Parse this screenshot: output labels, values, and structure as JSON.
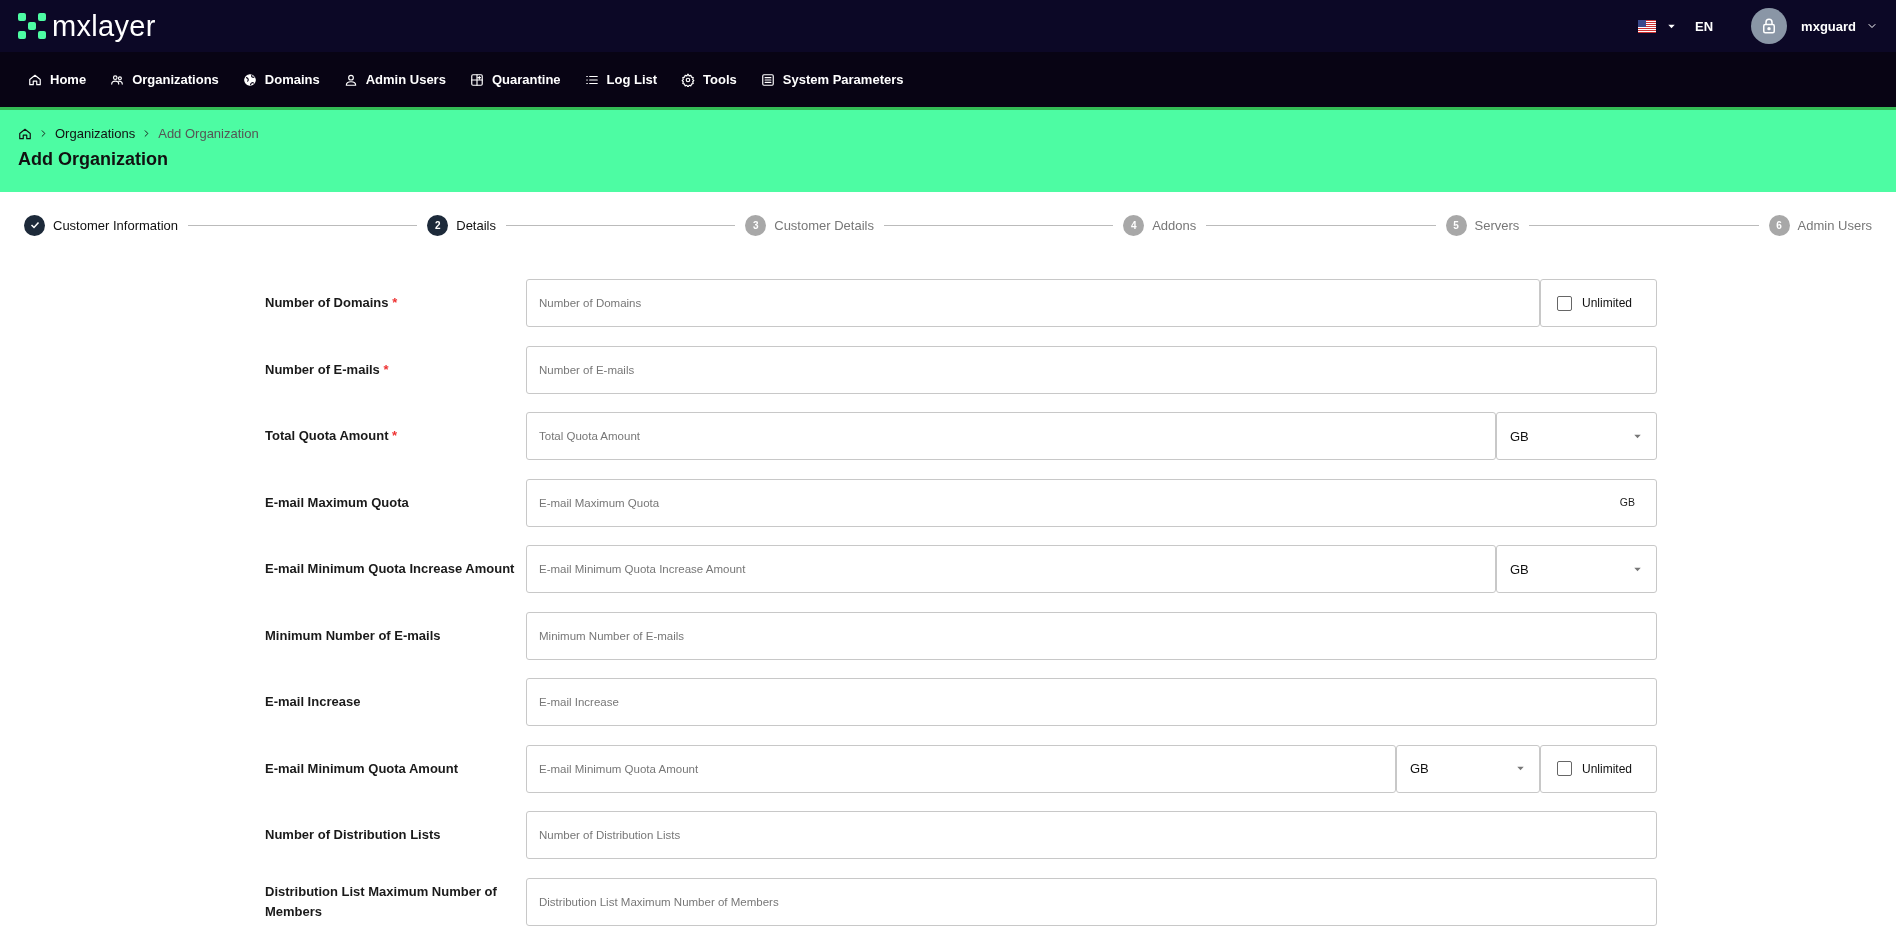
{
  "brand": {
    "name": "mxlayer"
  },
  "topbar": {
    "language": "EN",
    "user": "mxguard"
  },
  "nav": [
    {
      "label": "Home"
    },
    {
      "label": "Organizations"
    },
    {
      "label": "Domains"
    },
    {
      "label": "Admin Users"
    },
    {
      "label": "Quarantine"
    },
    {
      "label": "Log List"
    },
    {
      "label": "Tools"
    },
    {
      "label": "System Parameters"
    }
  ],
  "breadcrumb": [
    {
      "label": "Organizations",
      "current": false
    },
    {
      "label": "Add Organization",
      "current": true
    }
  ],
  "page_title": "Add Organization",
  "steps": [
    {
      "label": "Customer Information",
      "completed": true,
      "selected": false
    },
    {
      "number": "2",
      "label": "Details",
      "completed": false,
      "selected": true
    },
    {
      "number": "3",
      "label": "Customer Details",
      "completed": false,
      "selected": false
    },
    {
      "number": "4",
      "label": "Addons",
      "completed": false,
      "selected": false
    },
    {
      "number": "5",
      "label": "Servers",
      "completed": false,
      "selected": false
    },
    {
      "number": "6",
      "label": "Admin Users",
      "completed": false,
      "selected": false
    }
  ],
  "fields": [
    {
      "label": "Number of Domains",
      "required_mark": "*",
      "placeholder": "Number of Domains",
      "addons": [
        {
          "kind": "checkbox",
          "label": "Unlimited",
          "checked": false
        }
      ]
    },
    {
      "label": "Number of E-mails",
      "required_mark": "*",
      "placeholder": "Number of E-mails"
    },
    {
      "label": "Total Quota Amount",
      "required_mark": "*",
      "placeholder": "Total Quota Amount",
      "addons": [
        {
          "kind": "select",
          "value": "GB"
        }
      ]
    },
    {
      "label": "E-mail Maximum Quota",
      "placeholder": "E-mail Maximum Quota",
      "addons": [
        {
          "kind": "suffix",
          "text": "GB"
        }
      ]
    },
    {
      "label": "E-mail Minimum Quota Increase Amount",
      "placeholder": "E-mail Minimum Quota Increase Amount",
      "addons": [
        {
          "kind": "select",
          "value": "GB"
        }
      ]
    },
    {
      "label": "Minimum Number of E-mails",
      "placeholder": "Minimum Number of E-mails"
    },
    {
      "label": "E-mail Increase",
      "placeholder": "E-mail Increase"
    },
    {
      "label": "E-mail Minimum Quota Amount",
      "placeholder": "E-mail Minimum Quota Amount",
      "addons": [
        {
          "kind": "select",
          "value": "GB"
        },
        {
          "kind": "checkbox",
          "label": "Unlimited",
          "checked": false
        }
      ]
    },
    {
      "label": "Number of Distribution Lists",
      "placeholder": "Number of Distribution Lists"
    },
    {
      "label": "Distribution List Maximum Number of Members",
      "placeholder": "Distribution List Maximum Number of Members"
    }
  ]
}
